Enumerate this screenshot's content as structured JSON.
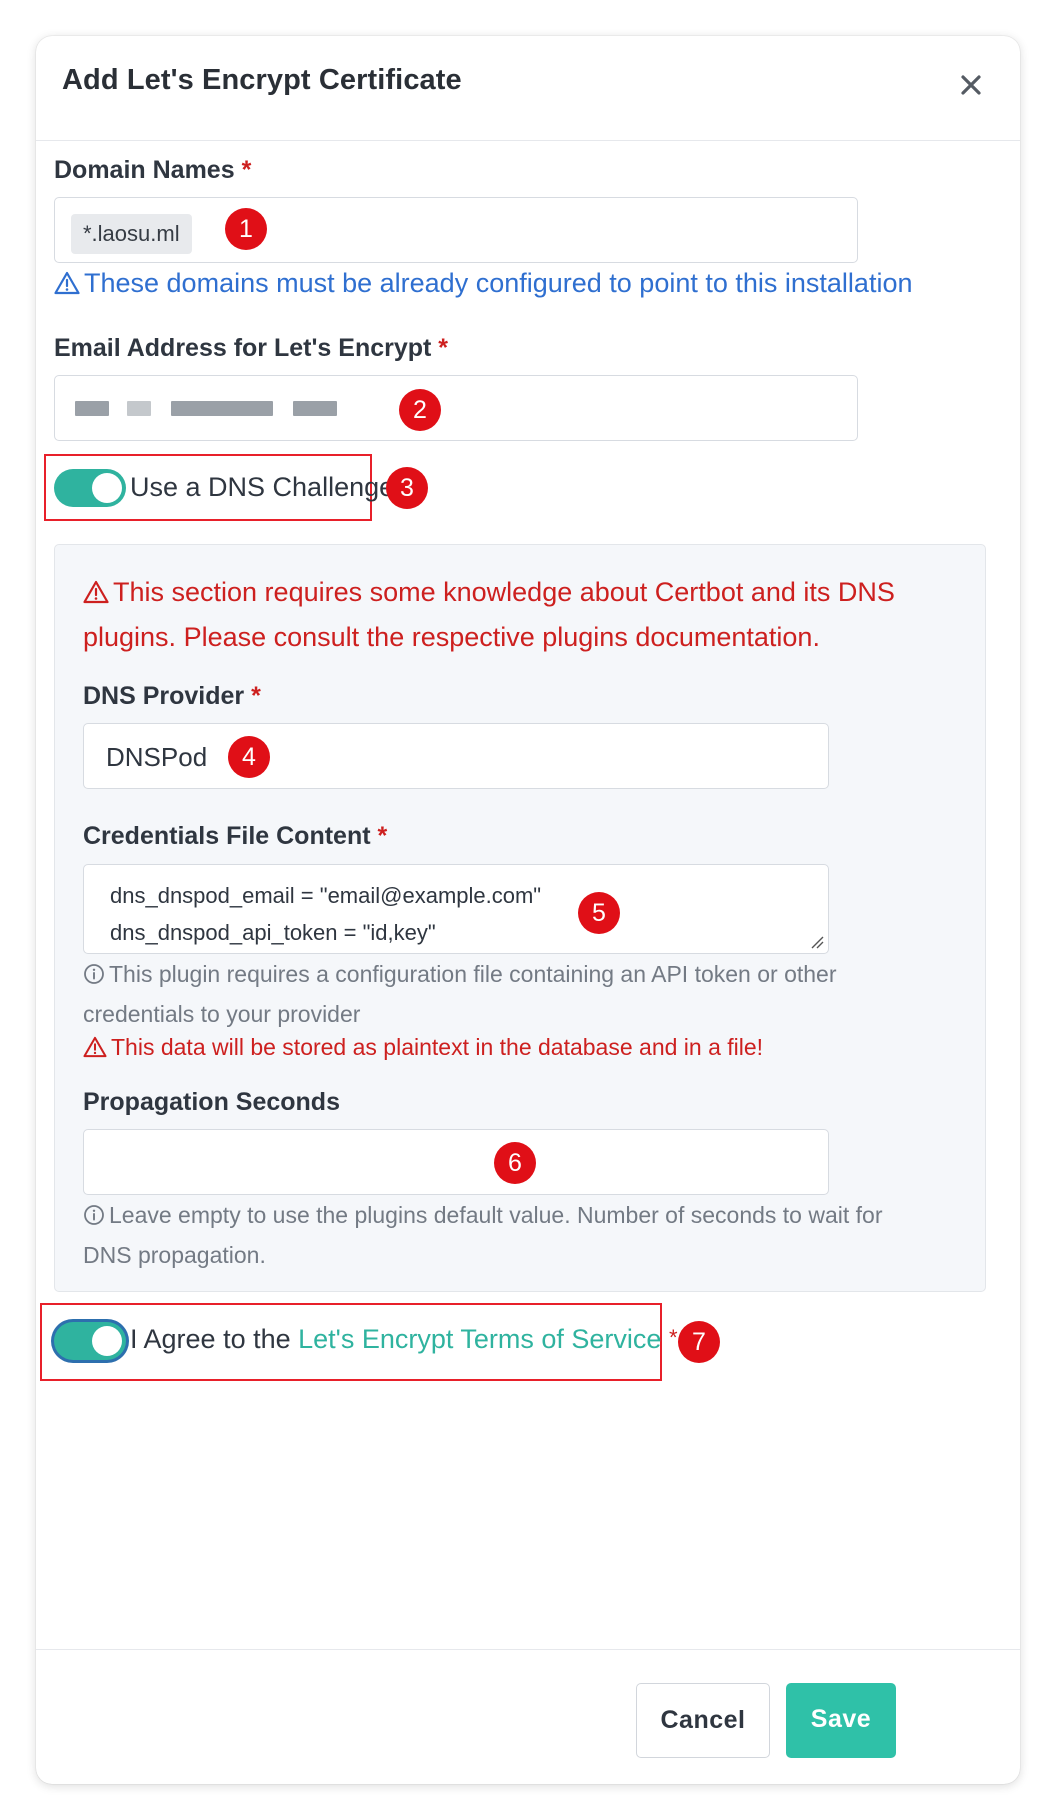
{
  "dialog": {
    "title": "Add Let's Encrypt Certificate",
    "close_icon": "close-icon"
  },
  "domain_names": {
    "label": "Domain Names",
    "required_mark": "*",
    "tags": [
      "*.laosu.ml"
    ],
    "hint": "These domains must be already configured to point to this installation",
    "hint_icon": "warning-triangle-icon"
  },
  "email": {
    "label": "Email Address for Let's Encrypt",
    "required_mark": "*",
    "value": "",
    "value_redacted": true
  },
  "dns_challenge": {
    "label": "Use a DNS Challenge",
    "enabled": true
  },
  "dns_section": {
    "warning_line1": "This section requires some knowledge about Certbot and its DNS",
    "warning_line2": "plugins. Please consult the respective plugins documentation.",
    "provider_label": "DNS Provider",
    "provider_required_mark": "*",
    "provider_value": "DNSPod",
    "credentials_label": "Credentials File Content",
    "credentials_required_mark": "*",
    "credentials_lines": [
      "dns_dnspod_email = \"email@example.com\"",
      "dns_dnspod_api_token = \"id,key\""
    ],
    "credentials_info_line1": "This plugin requires a configuration file containing an API token or other",
    "credentials_info_line2": "credentials to your provider",
    "credentials_warning": "This data will be stored as plaintext in the database and in a file!",
    "propagation_label": "Propagation Seconds",
    "propagation_value": "",
    "propagation_info_line1": "Leave empty to use the plugins default value. Number of seconds to wait for",
    "propagation_info_line2": "DNS propagation."
  },
  "agree": {
    "prefix": "I Agree to the ",
    "link_text": "Let's Encrypt Terms of Service",
    "required_mark": "*",
    "enabled": true
  },
  "footer": {
    "cancel_label": "Cancel",
    "save_label": "Save"
  },
  "annotations": [
    "1",
    "2",
    "3",
    "4",
    "5",
    "6",
    "7"
  ],
  "colors": {
    "accent": "#2fb39f",
    "save_button": "#2fc1a8",
    "danger": "#cd201f",
    "hint_blue": "#2f6fd0",
    "annotation_red": "#e00f17"
  }
}
